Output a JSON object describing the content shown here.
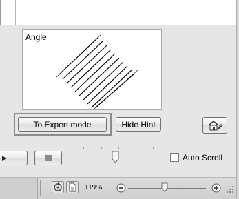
{
  "hint_panel": {
    "title": "Angle",
    "expert_button_label": "To Expert mode",
    "hide_hint_button_label": "Hide Hint",
    "home_icon": "home-settings-icon"
  },
  "playback": {
    "play_icon": "play-icon",
    "stop_icon": "stop-icon",
    "auto_scroll_label": "Auto Scroll",
    "auto_scroll_checked": false
  },
  "status_bar": {
    "zoom_label": "119%",
    "icons": [
      "refresh-icon",
      "page-icon",
      "zoom-out-icon",
      "zoom-in-icon",
      "resize-grip-icon"
    ]
  }
}
